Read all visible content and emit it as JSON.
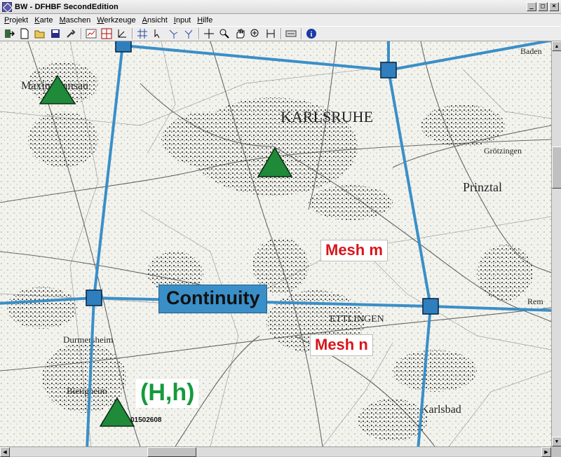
{
  "window": {
    "title": "BW - DFHBF SecondEdition",
    "minimize": "_",
    "maximize": "□",
    "close": "×"
  },
  "menu": [
    {
      "label": "Projekt",
      "ul": "P",
      "rest": "rojekt"
    },
    {
      "label": "Karte",
      "ul": "K",
      "rest": "arte"
    },
    {
      "label": "Maschen",
      "ul": "M",
      "rest": "aschen"
    },
    {
      "label": "Werkzeuge",
      "ul": "W",
      "rest": "erkzeuge"
    },
    {
      "label": "Ansicht",
      "ul": "A",
      "rest": "nsicht"
    },
    {
      "label": "Input",
      "ul": "I",
      "rest": "nput"
    },
    {
      "label": "Hilfe",
      "ul": "H",
      "rest": "ilfe"
    }
  ],
  "toolbar": {
    "icons": [
      "exit-icon",
      "new-file-icon",
      "open-folder-icon",
      "save-icon",
      "tools-icon",
      "separator",
      "chart-icon",
      "mesh-grid-icon",
      "axis-icon",
      "separator",
      "grid-icon",
      "select-node-icon",
      "add-node-icon",
      "move-node-icon",
      "separator",
      "crosshair-icon",
      "zoom-icon",
      "pan-hand-icon",
      "zoom-in-icon",
      "measure-icon",
      "separator",
      "keyboard-icon",
      "separator",
      "info-icon"
    ]
  },
  "overlay": {
    "mesh_m": "Mesh m",
    "mesh_n": "Mesh n",
    "continuity": "Continuity",
    "hh": "(H,h)",
    "node_code": "01502608"
  },
  "map_places": {
    "karlsruhe": "KARLSRUHE",
    "ettlingen": "ETTLINGEN",
    "maximiliansau": "Maximiliansau",
    "durmersheim": "Durmersheim",
    "bietigheim": "Bietigheim",
    "prinztal": "Prinztal",
    "karlsbad": "Karlsbad",
    "grotzingen": "Grötzingen",
    "baden": "Baden",
    "rem": "Rem"
  },
  "colors": {
    "mesh_line": "#3a8fc8",
    "node_fill": "#2f7fbf",
    "triangle_fill": "#1f8a3a",
    "mesh_label": "#d8141c",
    "hh_label": "#159a3c"
  }
}
